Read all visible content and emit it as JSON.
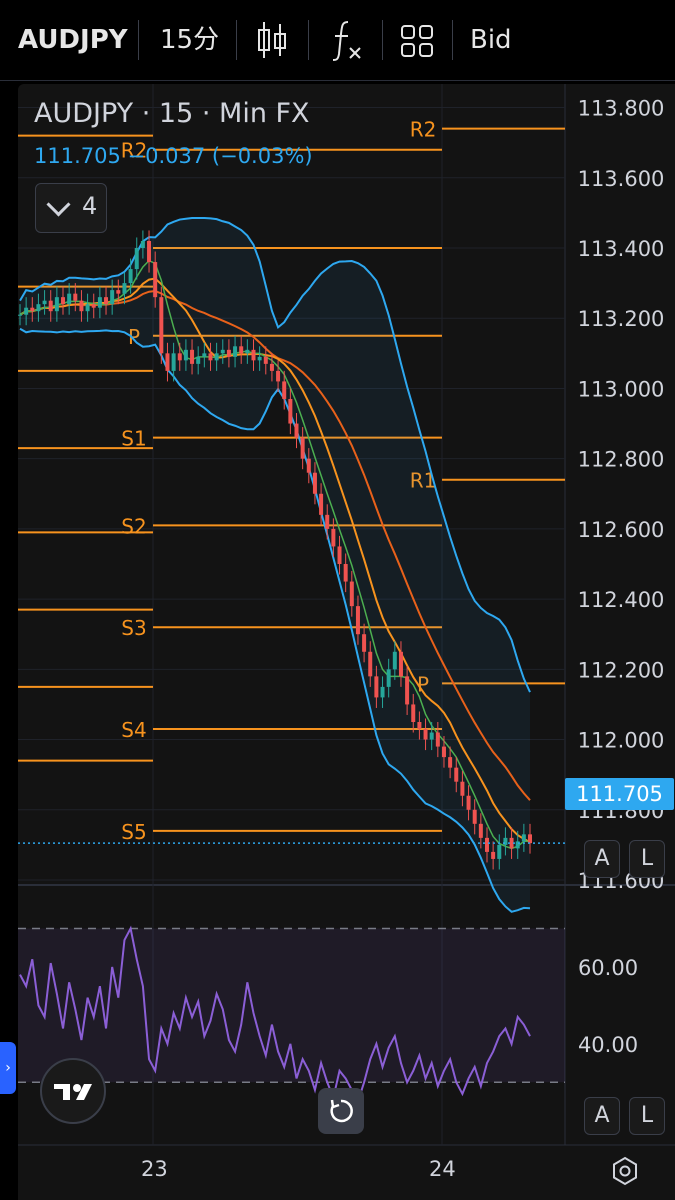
{
  "toolbar": {
    "symbol": "AUDJPY",
    "interval": "15分",
    "chart_type_icon": "candles-icon",
    "indicators_icon": "function-icon",
    "layout_icon": "grid-icon",
    "price_source": "Bid"
  },
  "legend": {
    "title": "AUDJPY · 15 · Min FX",
    "quote": "111.705 −0.037 (−0.03%)",
    "indicator_count": "4"
  },
  "colors": {
    "up": "#26a69a",
    "down": "#ef5350",
    "pivot": "#f7931e",
    "bollinger": "#2ea8f0",
    "rsi": "#8b5fd6",
    "price_line": "#2ea8f0"
  },
  "price_axis": {
    "ticks": [
      "113.800",
      "113.600",
      "113.400",
      "113.200",
      "113.000",
      "112.800",
      "112.600",
      "112.400",
      "112.200",
      "112.000",
      "111.800",
      "111.600"
    ],
    "last_price": "111.705"
  },
  "rsi_axis": {
    "ticks": [
      "60.00",
      "40.00"
    ]
  },
  "pivot_labels": {
    "left": [
      "R2",
      "P",
      "S1",
      "S2",
      "S3",
      "S4",
      "S5"
    ],
    "right": [
      "R2",
      "R1",
      "P"
    ]
  },
  "buttons": {
    "auto": "A",
    "log": "L"
  },
  "time_axis": {
    "labels": [
      "23",
      "24"
    ]
  },
  "chart_data": {
    "type": "line",
    "title": "AUDJPY · 15 · Min FX",
    "ylim": [
      111.6,
      113.85
    ],
    "close": [
      113.21,
      113.23,
      113.22,
      113.24,
      113.25,
      113.22,
      113.26,
      113.24,
      113.27,
      113.25,
      113.22,
      113.24,
      113.23,
      113.26,
      113.24,
      113.28,
      113.27,
      113.3,
      113.34,
      113.4,
      113.42,
      113.36,
      113.26,
      113.1,
      113.05,
      113.1,
      113.08,
      113.11,
      113.07,
      113.09,
      113.1,
      113.08,
      113.1,
      113.11,
      113.09,
      113.12,
      113.1,
      113.11,
      113.08,
      113.09,
      113.07,
      113.05,
      113.02,
      112.97,
      112.9,
      112.86,
      112.8,
      112.76,
      112.7,
      112.64,
      112.6,
      112.55,
      112.5,
      112.45,
      112.38,
      112.3,
      112.25,
      112.18,
      112.12,
      112.15,
      112.2,
      112.25,
      112.18,
      112.1,
      112.05,
      112.03,
      112.0,
      112.02,
      111.98,
      111.95,
      111.92,
      111.88,
      111.84,
      111.8,
      111.76,
      111.72,
      111.68,
      111.66,
      111.7,
      111.72,
      111.69,
      111.71,
      111.73,
      111.705
    ],
    "pivot_left": [
      {
        "name": "R2",
        "value": 113.72
      },
      {
        "name": "R1",
        "value": 113.29
      },
      {
        "name": "P",
        "value": 113.05
      },
      {
        "name": "S1",
        "value": 112.83
      },
      {
        "name": "S2",
        "value": 112.59
      },
      {
        "name": "S3",
        "value": 112.37
      },
      {
        "name": "S4",
        "value": 112.15
      },
      {
        "name": "S5",
        "value": 111.94
      }
    ],
    "pivot_mid": [
      {
        "name": "R2",
        "value": 113.68
      },
      {
        "name": "R1",
        "value": 113.4
      },
      {
        "name": "P",
        "value": 113.15
      },
      {
        "name": "S1",
        "value": 112.86
      },
      {
        "name": "S2",
        "value": 112.61
      },
      {
        "name": "S3",
        "value": 112.32
      },
      {
        "name": "S4",
        "value": 112.03
      },
      {
        "name": "S5",
        "value": 111.74
      }
    ],
    "pivot_right": [
      {
        "name": "R2",
        "value": 113.74
      },
      {
        "name": "R1",
        "value": 112.74
      },
      {
        "name": "P",
        "value": 112.16
      }
    ],
    "rsi": [
      58,
      55,
      62,
      50,
      47,
      61,
      53,
      44,
      56,
      49,
      41,
      52,
      47,
      55,
      44,
      60,
      52,
      67,
      70,
      62,
      55,
      36,
      33,
      44,
      40,
      48,
      44,
      52,
      47,
      51,
      42,
      46,
      53,
      49,
      41,
      38,
      45,
      56,
      48,
      42,
      37,
      45,
      38,
      34,
      40,
      31,
      36,
      33,
      28,
      35,
      30,
      26,
      33,
      31,
      28,
      25,
      30,
      36,
      40,
      34,
      39,
      42,
      35,
      30,
      33,
      37,
      31,
      35,
      29,
      33,
      36,
      30,
      27,
      31,
      34,
      29,
      35,
      38,
      42,
      44,
      40,
      47,
      45,
      42
    ],
    "rsi_levels": [
      70,
      30
    ],
    "rsi_ylim": [
      15,
      80
    ]
  }
}
